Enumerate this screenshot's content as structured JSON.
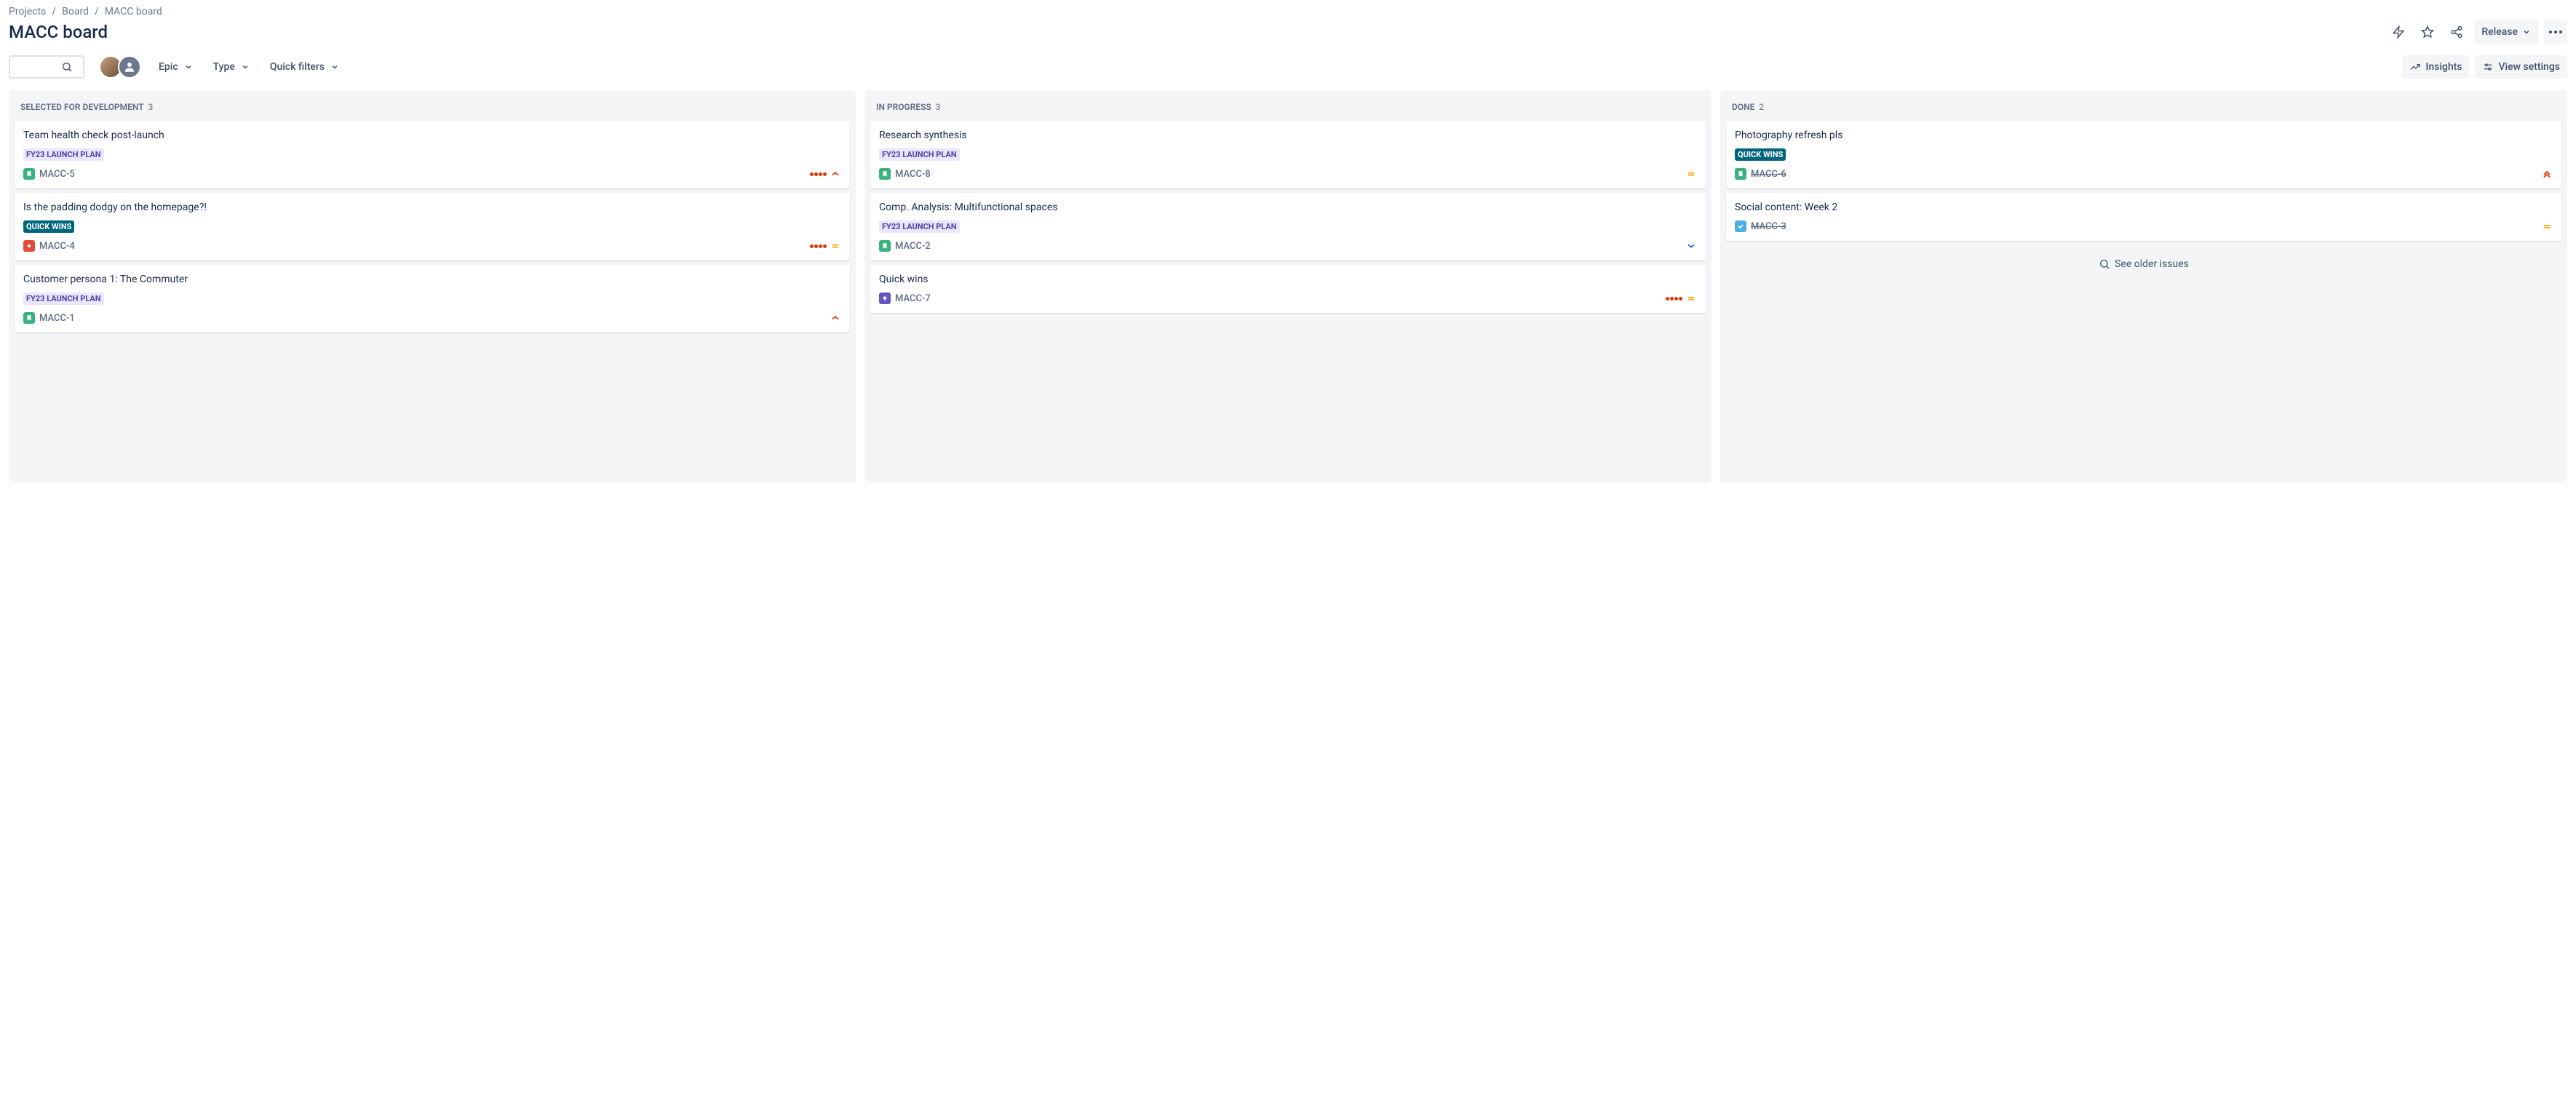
{
  "breadcrumb": {
    "items": [
      "Projects",
      "Board",
      "MACC board"
    ]
  },
  "page": {
    "title": "MACC board"
  },
  "header": {
    "release_label": "Release"
  },
  "toolbar": {
    "epic_label": "Epic",
    "type_label": "Type",
    "quickfilters_label": "Quick filters",
    "insights_label": "Insights",
    "viewsettings_label": "View settings"
  },
  "labels": {
    "fy23": "FY23 LAUNCH PLAN",
    "quickwins": "QUICK WINS"
  },
  "columns": [
    {
      "name": "Selected for Development",
      "count": 3,
      "cards": [
        {
          "title": "Team health check post-launch",
          "label": "fy23",
          "type": "story",
          "key": "MACC-5",
          "dots": 4,
          "priority": "high",
          "done": false
        },
        {
          "title": "Is the padding dodgy on the homepage?!",
          "label": "quickwins",
          "type": "bug",
          "key": "MACC-4",
          "dots": 4,
          "priority": "medium",
          "done": false
        },
        {
          "title": "Customer persona 1: The Commuter",
          "label": "fy23",
          "type": "story",
          "key": "MACC-1",
          "dots": 0,
          "priority": "high",
          "done": false
        }
      ]
    },
    {
      "name": "In Progress",
      "count": 3,
      "cards": [
        {
          "title": "Research synthesis",
          "label": "fy23",
          "type": "story",
          "key": "MACC-8",
          "dots": 0,
          "priority": "medium",
          "done": false
        },
        {
          "title": "Comp. Analysis: Multifunctional spaces",
          "label": "fy23",
          "type": "story",
          "key": "MACC-2",
          "dots": 0,
          "priority": "low",
          "done": false
        },
        {
          "title": "Quick wins",
          "label": "",
          "type": "epic",
          "key": "MACC-7",
          "dots": 4,
          "priority": "medium",
          "done": false
        }
      ]
    },
    {
      "name": "Done",
      "count": 2,
      "older_label": "See older issues",
      "cards": [
        {
          "title": "Photography refresh pls",
          "label": "quickwins",
          "type": "story",
          "key": "MACC-6",
          "dots": 0,
          "priority": "highest",
          "done": true
        },
        {
          "title": "Social content: Week 2",
          "label": "",
          "type": "task",
          "key": "MACC-3",
          "dots": 0,
          "priority": "medium",
          "done": true
        }
      ]
    }
  ]
}
